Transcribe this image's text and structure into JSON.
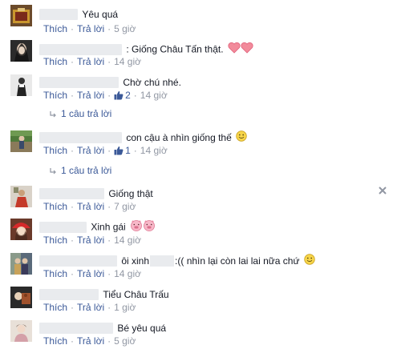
{
  "labels": {
    "like": "Thích",
    "reply": "Trả lời"
  },
  "comments": [
    {
      "text": "Yêu quá",
      "time": "5 giờ"
    },
    {
      "text": ": Giống Châu Tấn thật.",
      "time": "14 giờ"
    },
    {
      "text": "Chờ chú nhé.",
      "likes": "2",
      "time": "14 giờ",
      "replies": "1 câu trả lời"
    },
    {
      "text": "con cậu à nhìn giống thế",
      "likes": "1",
      "time": "14 giờ",
      "replies": "1 câu trả lời"
    },
    {
      "text": "Giống thật",
      "time": "7 giờ"
    },
    {
      "text": "Xinh gái",
      "time": "14 giờ"
    },
    {
      "text_a": "ôi xinh",
      "text_b": ":(( nhìn lại còn lai lai nữa chứ",
      "time": "14 giờ"
    },
    {
      "text": "Tiểu Châu Trấu",
      "time": "1 giờ"
    },
    {
      "text": "Bé yêu quá",
      "time": "5 giờ"
    }
  ],
  "icons": {
    "heart": "heart-icon",
    "smile": "smile-emoticon-icon",
    "pig": "pig-emoticon-icon",
    "like": "thumbs-up-icon",
    "reply_arrow": "reply-arrow-icon",
    "close": "close-icon"
  },
  "colors": {
    "link": "#3b5998",
    "muted": "#9197a3",
    "text": "#141823",
    "redacted": "#e9ebee"
  }
}
